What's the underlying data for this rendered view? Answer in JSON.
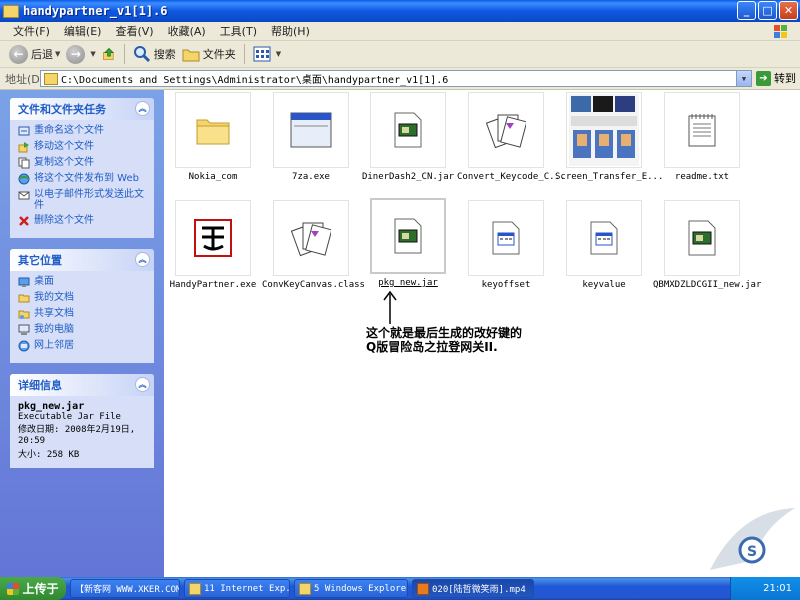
{
  "window": {
    "title": "handypartner_v1[1].6"
  },
  "menu": [
    "文件(F)",
    "编辑(E)",
    "查看(V)",
    "收藏(A)",
    "工具(T)",
    "帮助(H)"
  ],
  "toolbar": {
    "back": "后退",
    "search": "搜索",
    "folders": "文件夹"
  },
  "address": {
    "label": "地址(D)",
    "path": "C:\\Documents and Settings\\Administrator\\桌面\\handypartner_v1[1].6",
    "go": "转到"
  },
  "tasks_panel": {
    "title": "文件和文件夹任务",
    "items": [
      "重命名这个文件",
      "移动这个文件",
      "复制这个文件",
      "将这个文件发布到 Web",
      "以电子邮件形式发送此文件",
      "删除这个文件"
    ]
  },
  "places_panel": {
    "title": "其它位置",
    "items": [
      "桌面",
      "我的文档",
      "共享文档",
      "我的电脑",
      "网上邻居"
    ]
  },
  "details_panel": {
    "title": "详细信息",
    "name": "pkg_new.jar",
    "type": "Executable Jar File",
    "modified_label": "修改日期: 2008年2月19日, 20:59",
    "size_label": "大小: 258 KB"
  },
  "files": [
    {
      "name": "Nokia_com",
      "icon": "folder-icon"
    },
    {
      "name": "7za.exe",
      "icon": "window-icon"
    },
    {
      "name": "DinerDash2_CN.jar",
      "icon": "jar-icon"
    },
    {
      "name": "Convert_Keycode_C...",
      "icon": "cards-icon"
    },
    {
      "name": "Screen_Transfer_E...",
      "icon": "screenshot-icon"
    },
    {
      "name": "readme.txt",
      "icon": "notepad-icon"
    },
    {
      "name": "HandyPartner.exe",
      "icon": "handypartner-icon"
    },
    {
      "name": "ConvKeyCanvas.class",
      "icon": "cards-icon"
    },
    {
      "name": "pkg_new.jar",
      "icon": "jar-icon",
      "selected": true
    },
    {
      "name": "keyoffset",
      "icon": "generic-file-icon"
    },
    {
      "name": "keyvalue",
      "icon": "generic-file-icon"
    },
    {
      "name": "QBMXDZLDCGII_new.jar",
      "icon": "jar-icon"
    }
  ],
  "annotation": "这个就是最后生成的改好键的Q版冒险岛之拉登网关II.",
  "taskbar": {
    "start": "上传于",
    "items": [
      "【新客网 WWW.XKER.COM】",
      "11 Internet Exp...",
      "5 Windows Explorer",
      "020[陆哲微笑雨].mp4"
    ],
    "clock": "21:01"
  },
  "colors": {
    "title_bar": "#0b4fd0",
    "task_pane": "#7ba2e7",
    "link": "#215dc6",
    "taskbar": "#2457d0"
  }
}
